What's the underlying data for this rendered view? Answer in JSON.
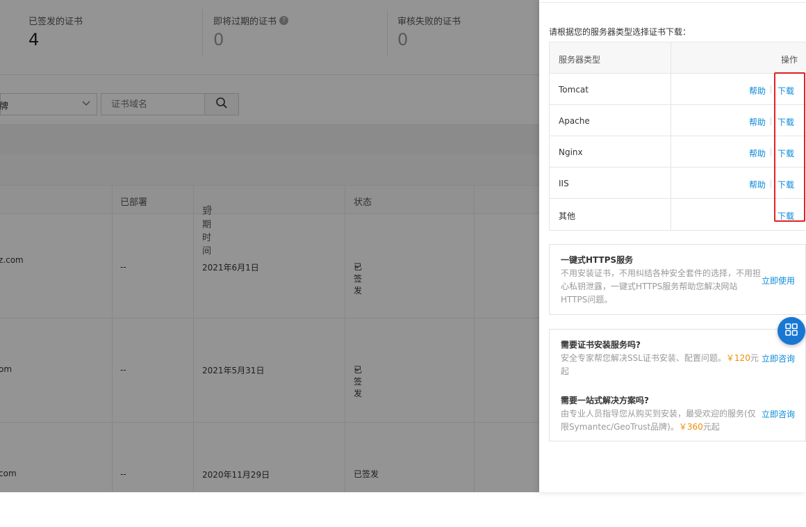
{
  "stats": [
    {
      "label": "已签发的证书",
      "value": "4"
    },
    {
      "label": "即将过期的证书",
      "value": "0",
      "help_icon": "?"
    },
    {
      "label": "审核失败的证书",
      "value": "0"
    }
  ],
  "filter": {
    "select_value": "牌",
    "search_placeholder": "证书域名"
  },
  "table": {
    "headers": [
      "已部署",
      "到期时间",
      "状态"
    ],
    "sort_icon": "⇅",
    "rows": [
      {
        "domain": "z.com",
        "deployed": "--",
        "expiry": "2021年6月1日",
        "status": "已签发",
        "status_caret": "⌄"
      },
      {
        "domain": "om",
        "deployed": "--",
        "expiry": "2021年5月31日",
        "status": "已签发",
        "status_caret": "⌄"
      },
      {
        "domain": "com",
        "deployed": "--",
        "expiry": "2020年11月29日",
        "status": "已签发",
        "status_caret": ""
      }
    ]
  },
  "drawer": {
    "intro": "请根据您的服务器类型选择证书下载：",
    "server_table": {
      "col_type": "服务器类型",
      "col_action": "操作",
      "rows": [
        {
          "name": "Tomcat",
          "help": "帮助",
          "download": "下载"
        },
        {
          "name": "Apache",
          "help": "帮助",
          "download": "下载"
        },
        {
          "name": "Nginx",
          "help": "帮助",
          "download": "下载"
        },
        {
          "name": "IIS",
          "help": "帮助",
          "download": "下载"
        },
        {
          "name": "其他",
          "help": "",
          "download": "下载"
        }
      ]
    },
    "https_card": {
      "title": "一键式HTTPS服务",
      "desc": "不用安装证书，不用纠结各种安全套件的选择，不用担心私钥泄露，一键式HTTPS服务帮助您解决网站HTTPS问题。",
      "link": "立即使用"
    },
    "install_card": {
      "title": "需要证书安装服务吗?",
      "desc_before": "安全专家帮您解决SSL证书安装、配置问题。",
      "price": "￥120",
      "desc_after": "元起",
      "link": "立即咨询"
    },
    "solution_card": {
      "title": "需要一站式解决方案吗?",
      "desc_before": "由专业人员指导您从购买到安装，最受欢迎的服务(仅限Symantec/GeoTrust品牌)。",
      "price": "￥360",
      "desc_after": "元起",
      "link": "立即咨询"
    }
  },
  "colors": {
    "link": "#0a89d8",
    "highlight_box": "#e02020",
    "price": "#f08c00",
    "float_button": "#1977d4"
  },
  "icons": {
    "search": "search-icon",
    "chevron": "chevron-down-icon",
    "float": "grid-apps-icon"
  }
}
